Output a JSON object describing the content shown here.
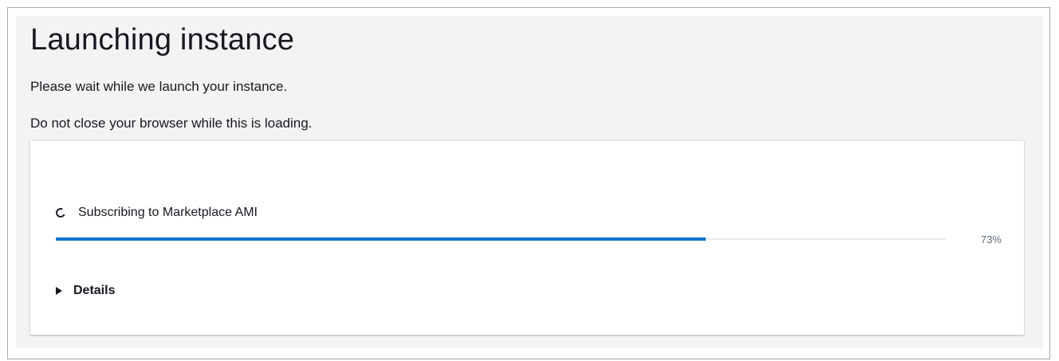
{
  "page": {
    "title": "Launching instance",
    "message_wait": "Please wait while we launch your instance.",
    "message_browser": "Do not close your browser while this is loading."
  },
  "progress": {
    "status_label": "Subscribing to Marketplace AMI",
    "status_icon": "spinner-icon",
    "value": 0.73,
    "percent_label": "73%",
    "fill_color": "#0972d3",
    "track_color": "#e9ebed"
  },
  "details": {
    "label": "Details",
    "icon": "caret-right-icon",
    "expanded": false
  }
}
